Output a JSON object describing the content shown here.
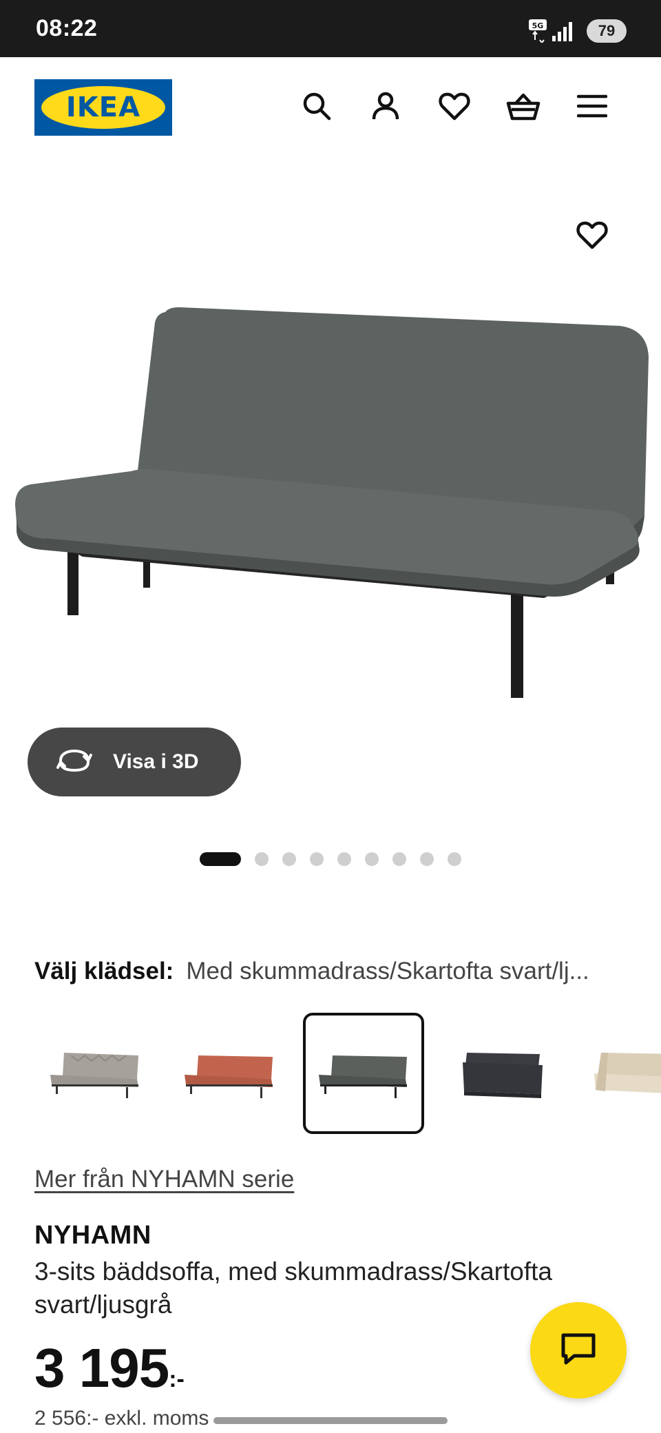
{
  "status_bar": {
    "time": "08:22",
    "network": "5G",
    "battery": "79"
  },
  "header": {
    "logo_text": "IKEA",
    "icons": [
      "search-icon",
      "user-icon",
      "heart-icon",
      "basket-icon",
      "menu-icon"
    ]
  },
  "gallery": {
    "view_3d_label": "Visa i 3D",
    "image_count": 9,
    "active_image": 1
  },
  "upholstery": {
    "label": "Välj klädsel:",
    "value": "Med skummadrass/Skartofta svart/lj..."
  },
  "swatches": [
    {
      "name": "light-grey-sofa",
      "selected": false,
      "color": "#a6a19a"
    },
    {
      "name": "red-brown-sofa",
      "selected": false,
      "color": "#c2644d"
    },
    {
      "name": "dark-grey-sofa",
      "selected": true,
      "color": "#5b605d"
    },
    {
      "name": "charcoal-sofa",
      "selected": false,
      "color": "#34363b"
    },
    {
      "name": "beige-sofa",
      "selected": false,
      "color": "#dccfb8"
    }
  ],
  "series_link": "Mer från NYHAMN serie",
  "product": {
    "name": "NYHAMN",
    "description": "3-sits bäddsoffa, med skummadrass/Skartofta svart/ljusgrå",
    "price": "3 195",
    "price_suffix": ":-",
    "price_ex_vat": "2 556:- exkl. moms"
  },
  "colors": {
    "ikea_blue": "#0058a3",
    "ikea_yellow": "#ffda1a",
    "chat_yellow": "#fbd914",
    "button_dark": "#474747"
  }
}
